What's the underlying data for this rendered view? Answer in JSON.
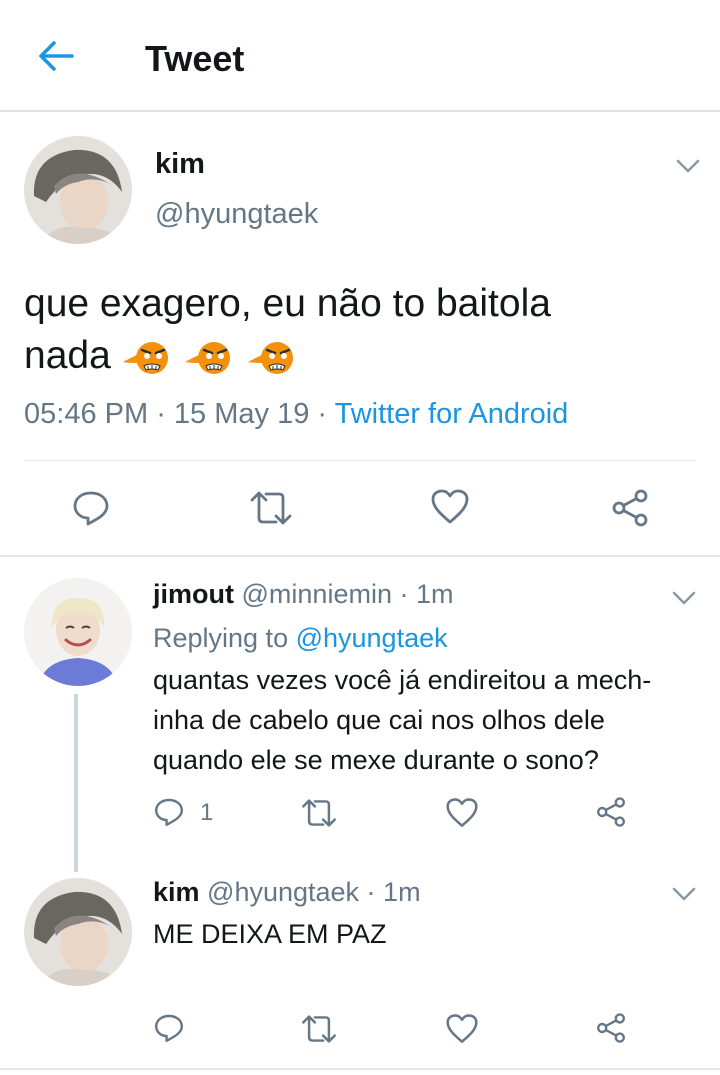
{
  "header": {
    "title": "Tweet"
  },
  "main_tweet": {
    "name": "kim",
    "handle": "@hyungtaek",
    "text_line1": "que exagero, eu não to baitola",
    "text_line2": "nada",
    "emojis": [
      "goblin-mask-emoji",
      "goblin-mask-emoji",
      "goblin-mask-emoji"
    ],
    "time": "05:46 PM",
    "separator": " · ",
    "date": "15 May 19",
    "source": "Twitter for Android"
  },
  "replies": [
    {
      "name": "jimout",
      "handle_time": "@minniemin · 1m",
      "replying_prefix": "Replying to ",
      "replying_to": "@hyungtaek",
      "text": "quantas vezes você já endireitou a mech-\ninha de cabelo que cai nos olhos dele\nquando ele se mexe durante o sono?",
      "reply_count": "1"
    },
    {
      "name": "kim",
      "handle_time": "@hyungtaek · 1m",
      "text": "ME DEIXA EM PAZ"
    }
  ],
  "colors": {
    "accent": "#1b95e0",
    "secondary_text": "#657786",
    "icon_gray": "#657786",
    "emoji_orange": "#f4900c"
  }
}
